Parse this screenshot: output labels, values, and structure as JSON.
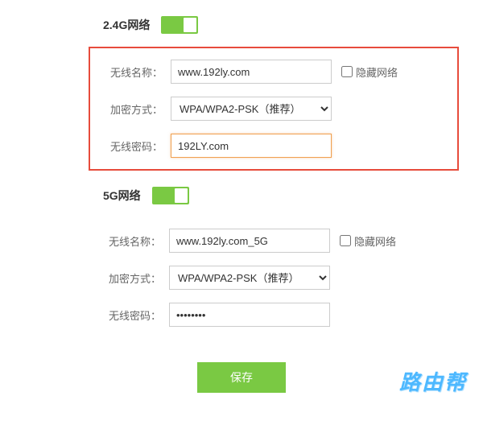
{
  "sections": {
    "g24": {
      "title": "2.4G网络",
      "toggle_on": true,
      "ssid_label": "无线名称：",
      "ssid_value": "www.192ly.com",
      "hide_label": "隐藏网络",
      "enc_label": "加密方式：",
      "enc_value": "WPA/WPA2-PSK（推荐）",
      "pwd_label": "无线密码：",
      "pwd_value": "192LY.com"
    },
    "g5": {
      "title": "5G网络",
      "toggle_on": true,
      "ssid_label": "无线名称：",
      "ssid_value": "www.192ly.com_5G",
      "hide_label": "隐藏网络",
      "enc_label": "加密方式：",
      "enc_value": "WPA/WPA2-PSK（推荐）",
      "pwd_label": "无线密码：",
      "pwd_value": "••••••••"
    }
  },
  "save_label": "保存",
  "watermark": "路由帮"
}
